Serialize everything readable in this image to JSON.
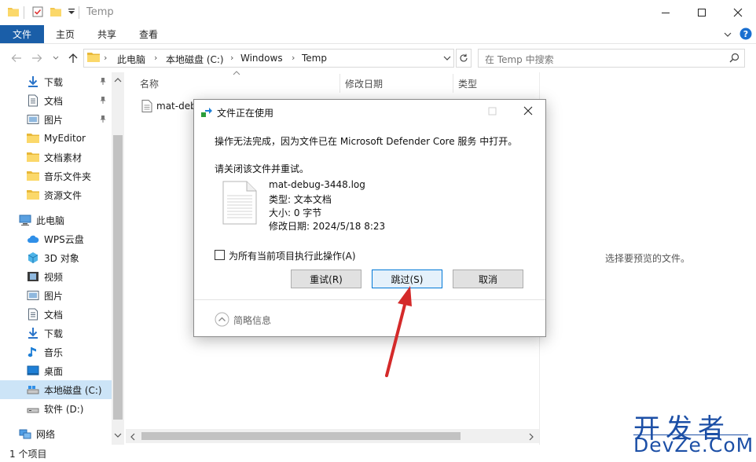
{
  "window": {
    "title": "Temp"
  },
  "ribbon": {
    "tabs": [
      "文件",
      "主页",
      "共享",
      "查看"
    ]
  },
  "address": {
    "crumbs": [
      "此电脑",
      "本地磁盘 (C:)",
      "Windows",
      "Temp"
    ],
    "search_placeholder": "在 Temp 中搜索"
  },
  "nav": {
    "quick_access": [
      {
        "label": "下载",
        "icon": "download-icon",
        "pinned": true
      },
      {
        "label": "文档",
        "icon": "document-icon",
        "pinned": true
      },
      {
        "label": "图片",
        "icon": "picture-icon",
        "pinned": true
      },
      {
        "label": "MyEditor",
        "icon": "folder-icon"
      },
      {
        "label": "文档素材",
        "icon": "folder-icon"
      },
      {
        "label": "音乐文件夹",
        "icon": "folder-icon"
      },
      {
        "label": "资源文件",
        "icon": "folder-icon"
      }
    ],
    "this_pc": "此电脑",
    "pc_items": [
      {
        "label": "WPS云盘",
        "icon": "cloud-icon"
      },
      {
        "label": "3D 对象",
        "icon": "cube-icon"
      },
      {
        "label": "视频",
        "icon": "video-icon"
      },
      {
        "label": "图片",
        "icon": "picture-icon"
      },
      {
        "label": "文档",
        "icon": "document-icon"
      },
      {
        "label": "下载",
        "icon": "download-icon"
      },
      {
        "label": "音乐",
        "icon": "music-icon"
      },
      {
        "label": "桌面",
        "icon": "desktop-icon"
      },
      {
        "label": "本地磁盘 (C:)",
        "icon": "drive-icon",
        "selected": true
      },
      {
        "label": "软件 (D:)",
        "icon": "drive-icon"
      }
    ],
    "network": "网络"
  },
  "list": {
    "columns": [
      "名称",
      "修改日期",
      "类型"
    ],
    "items": [
      "mat-debu"
    ]
  },
  "preview": {
    "text": "选择要预览的文件。"
  },
  "status": {
    "text": "1 个项目"
  },
  "dialog": {
    "title": "文件正在使用",
    "message": "操作无法完成，因为文件已在 Microsoft Defender Core 服务 中打开。",
    "hint": "请关闭该文件并重试。",
    "file_name": "mat-debug-3448.log",
    "file_type": "类型: 文本文档",
    "file_size": "大小: 0 字节",
    "file_modified": "修改日期: 2024/5/18 8:23",
    "checkbox_label": "为所有当前项目执行此操作(A)",
    "retry": "重试(R)",
    "skip": "跳过(S)",
    "cancel": "取消",
    "details": "简略信息"
  },
  "watermark": {
    "line1": "开发者",
    "line2": "DevZe.CoM"
  },
  "colors": {
    "accent": "#1a5ea8",
    "selection": "#cce4f7",
    "arrow": "#d42a2a",
    "watermark": "#1c4fa6"
  }
}
